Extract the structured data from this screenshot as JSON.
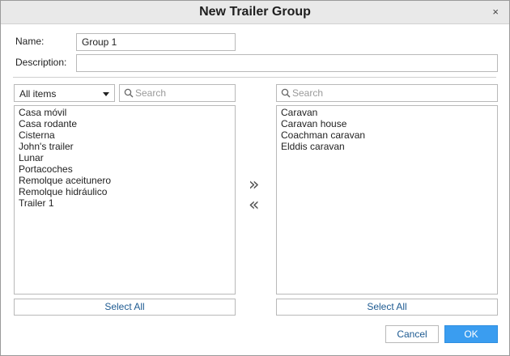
{
  "window": {
    "title": "New Trailer Group",
    "close_glyph": "×"
  },
  "form": {
    "name_label": "Name:",
    "name_value": "Group 1",
    "description_label": "Description:",
    "description_value": ""
  },
  "left_panel": {
    "filter_selected": "All items",
    "search_placeholder": "Search",
    "items": [
      "Casa móvil",
      "Casa rodante",
      "Cisterna",
      "John's trailer",
      "Lunar",
      "Portacoches",
      "Remolque aceitunero",
      "Remolque hidráulico",
      "Trailer 1"
    ],
    "select_all_label": "Select All"
  },
  "transfer": {
    "add_glyph": "»",
    "remove_glyph": "«"
  },
  "right_panel": {
    "search_placeholder": "Search",
    "items": [
      "Caravan",
      "Caravan house",
      "Coachman caravan",
      "Elddis caravan"
    ],
    "select_all_label": "Select All"
  },
  "footer": {
    "cancel_label": "Cancel",
    "ok_label": "OK"
  },
  "colors": {
    "accent": "#3a9df0",
    "link_text": "#1d5a91",
    "titlebar": "#e9e9e9"
  }
}
